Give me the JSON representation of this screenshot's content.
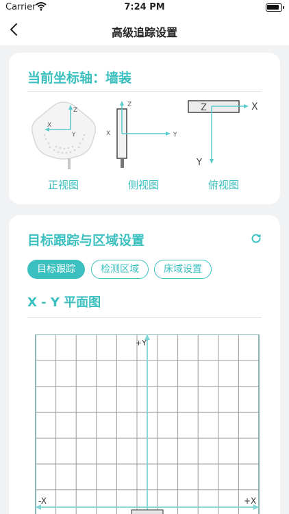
{
  "status": {
    "carrier": "Carrier",
    "time": "7:24 PM"
  },
  "nav": {
    "title": "高级追踪设置"
  },
  "axis_card": {
    "title": "当前坐标轴：墙装",
    "front_label": "正视图",
    "side_label": "侧视图",
    "top_label": "俯视图"
  },
  "tracking_card": {
    "title": "目标跟踪与区域设置",
    "tabs": [
      "目标跟踪",
      "检测区域",
      "床域设置"
    ],
    "plot_title": "X - Y 平面图",
    "axis_plus_y": "+Y",
    "axis_minus_x": "-X",
    "axis_plus_x": "+X"
  },
  "axis_letters": {
    "x": "X",
    "y": "Y",
    "z": "Z"
  },
  "colors": {
    "accent": "#3cbfbf",
    "grid": "#9a9a9a",
    "axis": "#7fd3d3"
  }
}
